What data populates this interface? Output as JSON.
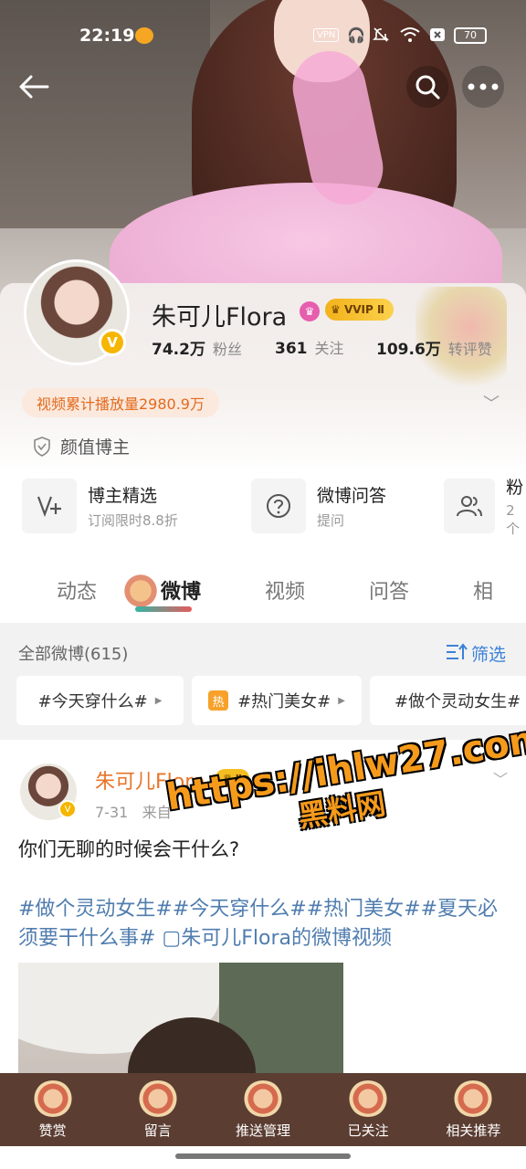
{
  "status_bar": {
    "time": "22:19",
    "vpn": "VPN",
    "battery": "70",
    "icons": [
      "weibo-icon",
      "headphones-icon",
      "mute-icon",
      "wifi-icon",
      "close-box-icon"
    ]
  },
  "header": {
    "back_icon": "arrow-left-icon",
    "search_icon": "search-icon",
    "more_icon": "more-dots-icon"
  },
  "profile": {
    "name": "朱可儿Flora",
    "vip_label": "VVIP Ⅱ",
    "verified": "V",
    "stats": [
      {
        "value": "74.2万",
        "label": "粉丝"
      },
      {
        "value": "361",
        "label": "关注"
      },
      {
        "value": "109.6万",
        "label": "转评赞"
      }
    ],
    "play_count": "视频累计播放量2980.9万",
    "tagline": "颜值博主"
  },
  "services": [
    {
      "title": "博主精选",
      "subtitle": "订阅限时8.8折",
      "icon": "v-plus-icon"
    },
    {
      "title": "微博问答",
      "subtitle": "提问",
      "icon": "question-icon"
    },
    {
      "title": "粉",
      "subtitle": "2个",
      "icon": "users-icon"
    }
  ],
  "tabs": [
    "动态",
    "微博",
    "视频",
    "问答",
    "相"
  ],
  "active_tab": "微博",
  "filter": {
    "title": "全部微博(615)",
    "filter_label": "筛选",
    "chips": [
      {
        "label": "#今天穿什么#",
        "hot": false
      },
      {
        "label": "#热门美女#",
        "hot": true,
        "hot_label": "热"
      },
      {
        "label": "#做个灵动女生#",
        "hot": false
      }
    ]
  },
  "post": {
    "author": "朱可儿Flora",
    "vip": "Ⅱ",
    "date": "7-31",
    "source_prefix": "来自",
    "text": "你们无聊的时候会干什么?",
    "tags": "#做个灵动女生##今天穿什么##热门美女##夏天必须要干什么事# ▢朱可儿Flora的微博视频"
  },
  "watermark": {
    "line1": "https://ihlw27.com",
    "line2": "黑料网"
  },
  "bottom_bar": [
    {
      "label": "赞赏"
    },
    {
      "label": "留言"
    },
    {
      "label": "推送管理"
    },
    {
      "label": "已关注"
    },
    {
      "label": "相关推荐"
    }
  ]
}
